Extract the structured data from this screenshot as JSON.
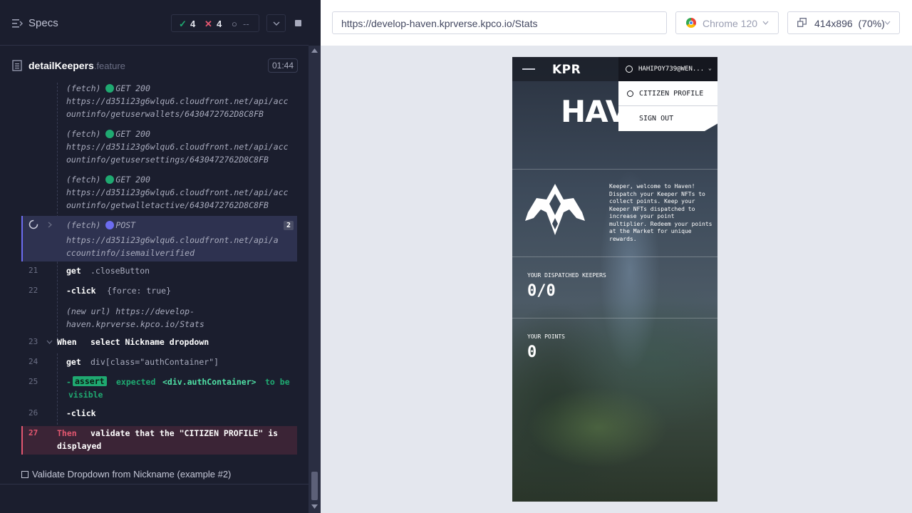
{
  "runner": {
    "specs_label": "Specs",
    "passed": "4",
    "failed": "4",
    "pending": "--",
    "file_name": "detailKeepers",
    "file_ext": ".feature",
    "duration": "01:44"
  },
  "log": {
    "entries": [
      {
        "label": "(fetch)",
        "method": "GET 200",
        "url_line1": "https://d351i23g6wlqu6.cloudfront.net/api/acc",
        "url_line2": "ountinfo/getuserwallets/6430472762D8C8FB"
      },
      {
        "label": "(fetch)",
        "method": "GET 200",
        "url_line1": "https://d351i23g6wlqu6.cloudfront.net/api/acc",
        "url_line2": "ountinfo/getusersettings/6430472762D8C8FB"
      },
      {
        "label": "(fetch)",
        "method": "GET 200",
        "url_line1": "https://d351i23g6wlqu6.cloudfront.net/api/acc",
        "url_line2": "ountinfo/getwalletactive/6430472762D8C8FB"
      },
      {
        "label": "(fetch)",
        "method": "POST",
        "count": "2",
        "url_line1": "https://d351i23g6wlqu6.cloudfront.net/api/a",
        "url_line2": "ccountinfo/isemailverified"
      }
    ],
    "step21": {
      "num": "21",
      "cmd": "get",
      "arg": ".closeButton"
    },
    "step22": {
      "num": "22",
      "cmd": "-click",
      "arg": "{force: true}"
    },
    "newurl": {
      "label": "(new url)",
      "url_line1": "https://develop-",
      "url_line2": "haven.kprverse.kpco.io/Stats"
    },
    "step23": {
      "num": "23",
      "cmd": "When",
      "arg": "select Nickname dropdown"
    },
    "step24": {
      "num": "24",
      "cmd": "get",
      "arg": "div[class=\"authContainer\"]"
    },
    "step25": {
      "num": "25",
      "dash": "-",
      "cmd": "assert",
      "word1": "expected",
      "selector": "<div.authContainer>",
      "word2": "to be",
      "word3": "visible"
    },
    "step26": {
      "num": "26",
      "cmd": "-click"
    },
    "step27": {
      "num": "27",
      "cmd": "Then",
      "arg_line1": "validate that the \"CITIZEN PROFILE\" is",
      "arg_line2": "displayed"
    },
    "example": "Validate Dropdown from Nickname (example #2)"
  },
  "browser": {
    "url": "https://develop-haven.kprverse.kpco.io/Stats",
    "browser_name": "Chrome 120",
    "viewport": "414x896",
    "zoom": "(70%)"
  },
  "app": {
    "logo": "KPR",
    "user": "HAHIPOY739@WEN...",
    "menu_item_1": "CITIZEN PROFILE",
    "menu_item_2": "SIGN OUT",
    "hero_word": "HAV",
    "welcome": "Keeper, welcome to Haven! Dispatch your Keeper NFTs to collect points. Keep your Keeper NFTs dispatched to increase your point multiplier. Redeem your points at the Market for unique rewards.",
    "dispatched_label": "YOUR DISPATCHED KEEPERS",
    "dispatched_value": "0/0",
    "points_label": "YOUR POINTS",
    "points_value": "0"
  },
  "colors": {
    "runner_bg": "#1b1e2e",
    "pass": "#1fa971",
    "fail": "#e45770",
    "running_bg": "#2e3250",
    "failed_step_bg": "#3b2436"
  }
}
